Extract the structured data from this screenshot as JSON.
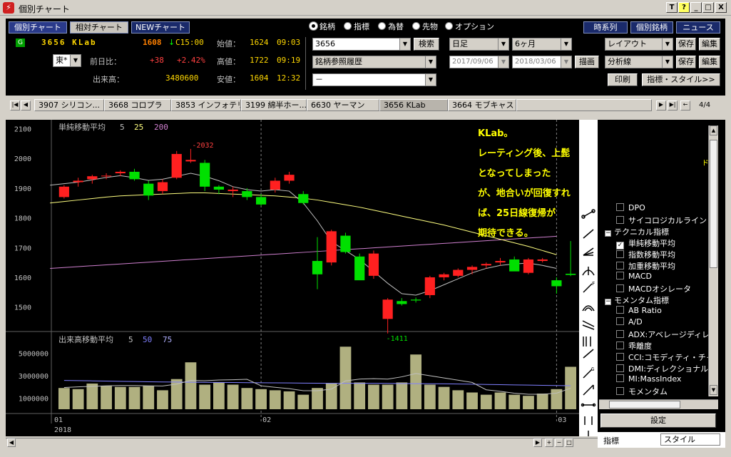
{
  "window": {
    "title": "個別チャート",
    "controls": [
      "T",
      "?",
      "_",
      "□",
      "X"
    ]
  },
  "top_tabs": [
    "個別チャート",
    "相対チャート",
    "NEWチャート"
  ],
  "stock": {
    "badge": "G",
    "code_name": "3656 KLab",
    "price": "1608",
    "arrow": "↓",
    "close_mark": "C15:00",
    "open_label": "始値：",
    "open_value": "1624",
    "open_time": "09:03",
    "prevday_label": "前日比：",
    "change": "+38",
    "change_pct": "+2.42%",
    "high_label": "高値：",
    "high_value": "1722",
    "high_time": "09:19",
    "volume_label": "出来高：",
    "volume_value": "3480600",
    "low_label": "安値：",
    "low_value": "1604",
    "low_time": "12:32",
    "market": "東*"
  },
  "asset_types": [
    {
      "label": "銘柄",
      "selected": true
    },
    {
      "label": "指標",
      "selected": false
    },
    {
      "label": "為替",
      "selected": false
    },
    {
      "label": "先物",
      "selected": false
    },
    {
      "label": "オプション",
      "selected": false
    }
  ],
  "search": {
    "code_value": "3656",
    "search_label": "検索",
    "history_value": "銘柄参照履歴",
    "third_value": "－"
  },
  "period": {
    "interval": "日足",
    "range": "6ヶ月",
    "from": "2017/09/06",
    "to": "2018/03/06",
    "draw_label": "描画"
  },
  "right_buttons": {
    "timeseries": "時系列",
    "stock_list": "個別銘柄",
    "news": "ニュース",
    "layout": "レイアウト",
    "save": "保存",
    "edit": "編集",
    "analysis": "分析線",
    "print": "印刷",
    "indicator_style": "指標・スタイル>>"
  },
  "stock_tabs": [
    "3907 シリコン...",
    "3668 コロプラ",
    "3853 インフォテリ",
    "3199 綿半ホー...",
    "6630 ヤーマン",
    "3656 KLab",
    "3664 モブキャス"
  ],
  "tab_page": "4/4",
  "chart_data": [
    {
      "type": "candlestick",
      "indicator_label": "単純移動平均",
      "ma_periods": [
        "5",
        "25",
        "200"
      ],
      "ma_colors": [
        "#c0c0c0",
        "#ffff80",
        "#d080d0"
      ],
      "y_ticks": [
        2100,
        2000,
        1900,
        1800,
        1700,
        1600,
        1500
      ],
      "ylim": [
        1420,
        2130
      ],
      "max_label": "-2032",
      "min_label": "-1411",
      "candles": [
        {
          "o": 1870,
          "h": 1910,
          "l": 1865,
          "c": 1905
        },
        {
          "o": 1920,
          "h": 1935,
          "l": 1905,
          "c": 1925
        },
        {
          "o": 1930,
          "h": 1945,
          "l": 1915,
          "c": 1940
        },
        {
          "o": 1940,
          "h": 1950,
          "l": 1930,
          "c": 1942
        },
        {
          "o": 1950,
          "h": 1960,
          "l": 1940,
          "c": 1955
        },
        {
          "o": 1955,
          "h": 1965,
          "l": 1925,
          "c": 1930
        },
        {
          "o": 1915,
          "h": 1925,
          "l": 1860,
          "c": 1875
        },
        {
          "o": 1890,
          "h": 1930,
          "l": 1880,
          "c": 1920
        },
        {
          "o": 1935,
          "h": 2025,
          "l": 1930,
          "c": 2015
        },
        {
          "o": 1990,
          "h": 2032,
          "l": 1985,
          "c": 1995
        },
        {
          "o": 1985,
          "h": 1995,
          "l": 1890,
          "c": 1905
        },
        {
          "o": 1905,
          "h": 1910,
          "l": 1880,
          "c": 1895
        },
        {
          "o": 1890,
          "h": 1905,
          "l": 1870,
          "c": 1895
        },
        {
          "o": 1890,
          "h": 1900,
          "l": 1860,
          "c": 1870
        },
        {
          "o": 1870,
          "h": 1880,
          "l": 1840,
          "c": 1845
        },
        {
          "o": 1895,
          "h": 1935,
          "l": 1885,
          "c": 1925
        },
        {
          "o": 1925,
          "h": 1955,
          "l": 1915,
          "c": 1945
        },
        {
          "o": 1880,
          "h": 1890,
          "l": 1845,
          "c": 1850
        },
        {
          "o": 1655,
          "h": 1735,
          "l": 1560,
          "c": 1610
        },
        {
          "o": 1650,
          "h": 1760,
          "l": 1640,
          "c": 1755
        },
        {
          "o": 1740,
          "h": 1750,
          "l": 1680,
          "c": 1685
        },
        {
          "o": 1670,
          "h": 1680,
          "l": 1595,
          "c": 1590
        },
        {
          "o": 1605,
          "h": 1690,
          "l": 1595,
          "c": 1680
        },
        {
          "o": 1460,
          "h": 1530,
          "l": 1411,
          "c": 1525
        },
        {
          "o": 1520,
          "h": 1530,
          "l": 1505,
          "c": 1510
        },
        {
          "o": 1525,
          "h": 1532,
          "l": 1515,
          "c": 1522
        },
        {
          "o": 1540,
          "h": 1605,
          "l": 1530,
          "c": 1600
        },
        {
          "o": 1600,
          "h": 1615,
          "l": 1590,
          "c": 1610
        },
        {
          "o": 1605,
          "h": 1630,
          "l": 1600,
          "c": 1625
        },
        {
          "o": 1625,
          "h": 1640,
          "l": 1610,
          "c": 1635
        },
        {
          "o": 1640,
          "h": 1650,
          "l": 1630,
          "c": 1645
        },
        {
          "o": 1650,
          "h": 1665,
          "l": 1640,
          "c": 1655
        },
        {
          "o": 1660,
          "h": 1670,
          "l": 1625,
          "c": 1620
        },
        {
          "o": 1615,
          "h": 1665,
          "l": 1610,
          "c": 1660
        },
        {
          "o": 1655,
          "h": 1665,
          "l": 1650,
          "c": 1660
        },
        {
          "o": 1590,
          "h": 1600,
          "l": 1545,
          "c": 1570
        },
        {
          "o": 1612,
          "h": 1722,
          "l": 1604,
          "c": 1608
        }
      ],
      "ma5": [
        1910,
        1915,
        1920,
        1928,
        1936,
        1942,
        1935,
        1926,
        1930,
        1940,
        1950,
        1940,
        1925,
        1905,
        1895,
        1890,
        1895,
        1890,
        1850,
        1790,
        1720,
        1690,
        1660,
        1620,
        1580,
        1545,
        1540,
        1555,
        1575,
        1595,
        1615,
        1630,
        1640,
        1645,
        1648,
        1640,
        1630
      ],
      "ma25": [
        1850,
        1855,
        1860,
        1865,
        1870,
        1874,
        1876,
        1878,
        1880,
        1882,
        1884,
        1884,
        1882,
        1880,
        1878,
        1876,
        1874,
        1870,
        1866,
        1860,
        1852,
        1844,
        1836,
        1826,
        1816,
        1806,
        1796,
        1786,
        1776,
        1764,
        1752,
        1740,
        1728,
        1716,
        1704,
        1690,
        1676
      ],
      "ma200": [
        1630,
        1633,
        1636,
        1639,
        1642,
        1645,
        1648,
        1651,
        1654,
        1657,
        1660,
        1663,
        1666,
        1669,
        1672,
        1675,
        1678,
        1681,
        1684,
        1687,
        1690,
        1693,
        1696,
        1699,
        1702,
        1705,
        1708,
        1711,
        1714,
        1717,
        1720,
        1723,
        1726,
        1729,
        1732,
        1735,
        1738
      ]
    },
    {
      "type": "bar",
      "indicator_label": "出来高移動平均",
      "ma_periods": [
        "5",
        "50",
        "75"
      ],
      "ma_colors": [
        "#c0c0c0",
        "#8080ff",
        "#b0b0ff"
      ],
      "y_ticks": [
        5000000,
        3000000,
        1000000
      ],
      "y_tick_labels": [
        "5000000",
        "3000000",
        "1000000"
      ],
      "ylim": [
        0,
        6000000
      ],
      "volumes": [
        2100000,
        1900000,
        1800000,
        2300000,
        2100000,
        2000000,
        2000000,
        2100000,
        1700000,
        2700000,
        4200000,
        2200000,
        2400000,
        2200000,
        1900000,
        1800000,
        1700000,
        1600000,
        1300000,
        1900000,
        2300000,
        5600000,
        2400000,
        2200000,
        2200000,
        2400000,
        4900000,
        2200000,
        2000000,
        1700000,
        1500000,
        1300000,
        1500000,
        1300000,
        1200000,
        1400000,
        1800000,
        3800000
      ],
      "vol_ma5": [
        1900000,
        1950000,
        2000000,
        2050000,
        2100000,
        2120000,
        2120000,
        2100000,
        2080000,
        2250000,
        2580000,
        2550000,
        2620000,
        2640000,
        2680000,
        2100000,
        1960000,
        1840000,
        1660000,
        1660000,
        1800000,
        2540000,
        2700000,
        2740000,
        2700000,
        2900000,
        3200000,
        3000000,
        2800000,
        2600000,
        2400000,
        1740000,
        1600000,
        1440000,
        1340000,
        1340000,
        1440000,
        1880000
      ],
      "vol_ma50": [
        2600000,
        2580000,
        2560000,
        2540000,
        2520000,
        2500000,
        2480000,
        2460000,
        2440000,
        2430000,
        2420000,
        2410000,
        2400000,
        2390000,
        2380000,
        2370000,
        2360000,
        2350000,
        2340000,
        2330000,
        2320000,
        2320000,
        2320000,
        2320000,
        2310000,
        2300000,
        2290000,
        2280000,
        2270000,
        2260000,
        2240000,
        2220000,
        2200000,
        2180000,
        2160000,
        2140000,
        2120000,
        2110000
      ]
    }
  ],
  "x_axis": {
    "labels": [
      "01",
      "02",
      "03"
    ],
    "year": "2018"
  },
  "annotation": {
    "lines": [
      "KLab。",
      "レーティング後、上髭となってしまった",
      "が、地合いが回復すれば、25日線復帰が",
      "期待できる。"
    ]
  },
  "tree": {
    "items": [
      {
        "kind": "check",
        "label": "DPO",
        "checked": false
      },
      {
        "kind": "check",
        "label": "サイコロジカルライン",
        "checked": false
      },
      {
        "kind": "group",
        "label": "テクニカル指標"
      },
      {
        "kind": "check",
        "label": "単純移動平均",
        "checked": true
      },
      {
        "kind": "check",
        "label": "指数移動平均",
        "checked": false
      },
      {
        "kind": "check",
        "label": "加重移動平均",
        "checked": false
      },
      {
        "kind": "check",
        "label": "MACD",
        "checked": false
      },
      {
        "kind": "check",
        "label": "MACDオシレータ",
        "checked": false
      },
      {
        "kind": "group",
        "label": "モメンタム指標"
      },
      {
        "kind": "check",
        "label": "AB Ratio",
        "checked": false
      },
      {
        "kind": "check",
        "label": "A/D",
        "checked": false
      },
      {
        "kind": "check",
        "label": "ADX:アベレージディレ",
        "checked": false
      },
      {
        "kind": "check",
        "label": "乖離度",
        "checked": false
      },
      {
        "kind": "check",
        "label": "CCI:コモディティ・チャ",
        "checked": false
      },
      {
        "kind": "check",
        "label": "DMI:ディレクショナル",
        "checked": false
      },
      {
        "kind": "check",
        "label": "MI:MassIndex",
        "checked": false
      },
      {
        "kind": "check",
        "label": "モメンタム",
        "checked": false
      }
    ],
    "settings_label": "設定",
    "tab_indicators": "指標",
    "tab_style": "スタイル",
    "hidden_text": "ド"
  },
  "colors": {
    "up": "#ff2020",
    "down": "#00e000",
    "volume": "#b0b080",
    "annotation": "#ffff00"
  }
}
